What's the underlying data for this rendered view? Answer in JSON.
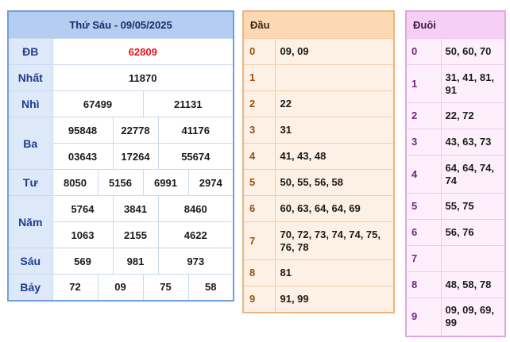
{
  "results": {
    "title": "Thứ Sáu - 09/05/2025",
    "colors": {
      "special": "#e8141c",
      "accent": "#6fa0de"
    },
    "db": {
      "label": "ĐB",
      "value": "62809"
    },
    "nhat": {
      "label": "Nhất",
      "value": "11870"
    },
    "nhi": {
      "label": "Nhì",
      "values": [
        "67499",
        "21131"
      ]
    },
    "ba": {
      "label": "Ba",
      "values": [
        "95848",
        "22778",
        "41176",
        "03643",
        "17264",
        "55674"
      ]
    },
    "tu": {
      "label": "Tư",
      "values": [
        "8050",
        "5156",
        "6991",
        "2974"
      ]
    },
    "nam": {
      "label": "Năm",
      "values": [
        "5764",
        "3841",
        "8460",
        "1063",
        "2155",
        "4622"
      ]
    },
    "sau": {
      "label": "Sáu",
      "values": [
        "569",
        "981",
        "973"
      ]
    },
    "bay": {
      "label": "Bảy",
      "values": [
        "72",
        "09",
        "75",
        "58"
      ]
    }
  },
  "dau": {
    "header": "Đầu",
    "rows": [
      {
        "key": "0",
        "value": "09, 09"
      },
      {
        "key": "1",
        "value": ""
      },
      {
        "key": "2",
        "value": "22"
      },
      {
        "key": "3",
        "value": "31"
      },
      {
        "key": "4",
        "value": "41, 43, 48"
      },
      {
        "key": "5",
        "value": "50, 55, 56, 58"
      },
      {
        "key": "6",
        "value": "60, 63, 64, 64, 69"
      },
      {
        "key": "7",
        "value": "70, 72, 73, 74, 74, 75, 76, 78"
      },
      {
        "key": "8",
        "value": "81"
      },
      {
        "key": "9",
        "value": "91, 99"
      }
    ]
  },
  "duoi": {
    "header": "Đuôi",
    "rows": [
      {
        "key": "0",
        "value": "50, 60, 70"
      },
      {
        "key": "1",
        "value": "31, 41, 81, 91"
      },
      {
        "key": "2",
        "value": "22, 72"
      },
      {
        "key": "3",
        "value": "43, 63, 73"
      },
      {
        "key": "4",
        "value": "64, 64, 74, 74"
      },
      {
        "key": "5",
        "value": "55, 75"
      },
      {
        "key": "6",
        "value": "56, 76"
      },
      {
        "key": "7",
        "value": ""
      },
      {
        "key": "8",
        "value": "48, 58, 78"
      },
      {
        "key": "9",
        "value": "09, 09, 69, 99"
      }
    ]
  }
}
